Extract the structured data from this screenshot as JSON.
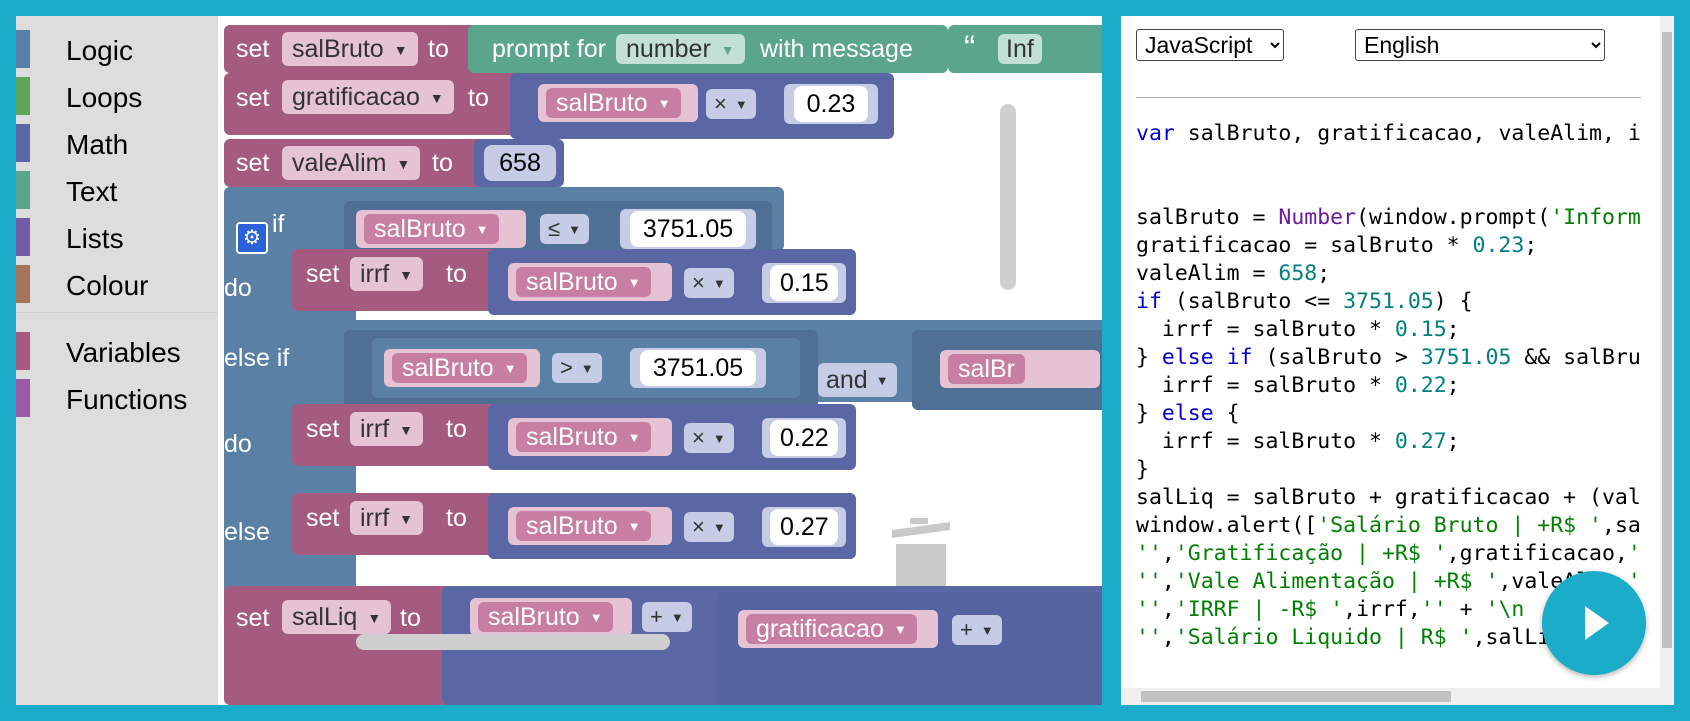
{
  "toolbox": {
    "categories": [
      {
        "label": "Logic",
        "color": "#5b80a5"
      },
      {
        "label": "Loops",
        "color": "#5ba55b"
      },
      {
        "label": "Math",
        "color": "#5b67a5"
      },
      {
        "label": "Text",
        "color": "#5ba58c"
      },
      {
        "label": "Lists",
        "color": "#745ba5"
      },
      {
        "label": "Colour",
        "color": "#a5745b"
      },
      {
        "label": "Variables",
        "color": "#a55b80"
      },
      {
        "label": "Functions",
        "color": "#995ba5"
      }
    ]
  },
  "workspace": {
    "set": "set",
    "to": "to",
    "prompt_for": "prompt for",
    "prompt_type": "number",
    "with_message": "with message",
    "quote": "“",
    "msg_start": "Inf",
    "var_salBruto": "salBruto",
    "var_gratificacao": "gratificacao",
    "var_valeAlim": "valeAlim",
    "var_irrf": "irrf",
    "var_salLiq": "salLiq",
    "op_mult": "×",
    "op_le": "≤",
    "op_gt": ">",
    "op_plus": "+",
    "and": "and",
    "val_023": "0.23",
    "val_658": "658",
    "val_375105": "3751.05",
    "val_015": "0.15",
    "val_022": "0.22",
    "val_027": "0.27",
    "if": "if",
    "do": "do",
    "else_if": "else if",
    "else": "else",
    "salBr_trunc": "salBr"
  },
  "code_panel": {
    "language": "JavaScript",
    "locale": "English",
    "lines": [
      "var salBruto, gratificacao, valeAlim, i",
      "",
      "",
      "salBruto = Number(window.prompt('Inform",
      "gratificacao = salBruto * 0.23;",
      "valeAlim = 658;",
      "if (salBruto <= 3751.05) {",
      "  irrf = salBruto * 0.15;",
      "} else if (salBruto > 3751.05 && salBru",
      "  irrf = salBruto * 0.22;",
      "} else {",
      "  irrf = salBruto * 0.27;",
      "}",
      "salLiq = salBruto + gratificacao + (val",
      "window.alert(['Salário Bruto | +R$ ',sa",
      "'','Gratificação | +R$ ',gratificacao,'",
      "'','Vale Alimentação | +R$ ',valeAlim,'",
      "'','IRRF | -R$ ',irrf,'' + '\\n",
      "'','Salário Liquido | R$ ',salLiq,''].j"
    ]
  }
}
